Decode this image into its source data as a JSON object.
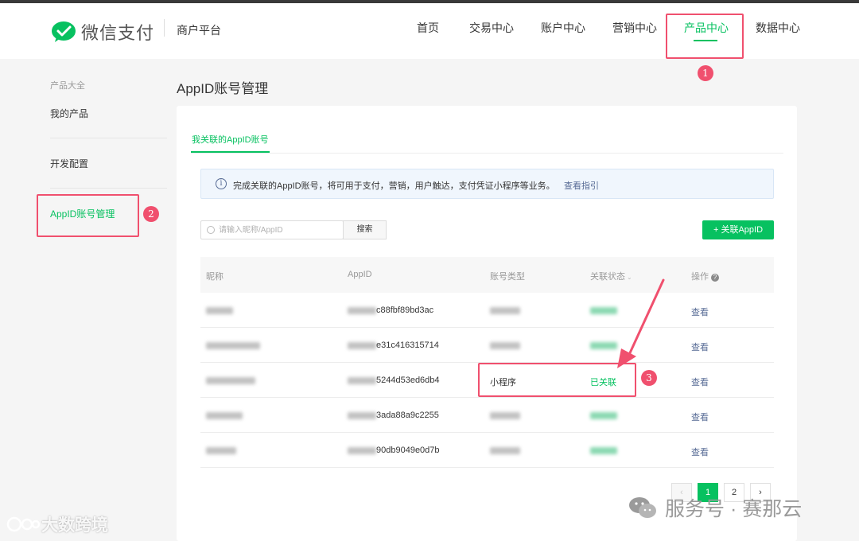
{
  "header": {
    "logo_text": "微信支付",
    "platform": "商户平台",
    "nav": [
      {
        "label": "首页",
        "active": false
      },
      {
        "label": "交易中心",
        "active": false
      },
      {
        "label": "账户中心",
        "active": false
      },
      {
        "label": "营销中心",
        "active": false
      },
      {
        "label": "产品中心",
        "active": true
      },
      {
        "label": "数据中心",
        "active": false
      }
    ]
  },
  "sidebar": {
    "group_label": "产品大全",
    "items": [
      {
        "label": "我的产品",
        "active": false
      },
      {
        "label": "开发配置",
        "active": false
      },
      {
        "label": "AppID账号管理",
        "active": true
      }
    ]
  },
  "page": {
    "title": "AppID账号管理",
    "tab_label": "我关联的AppID账号",
    "notice": {
      "text": "完成关联的AppID账号，将可用于支付，营销，用户触达，支付凭证小程序等业务。",
      "link": "查看指引"
    },
    "search": {
      "placeholder": "请输入昵称/AppID",
      "button_label": "搜索"
    },
    "add_button": "+ 关联AppID"
  },
  "table": {
    "headers": {
      "nickname": "昵称",
      "appid": "AppID",
      "type": "账号类型",
      "status": "关联状态",
      "action": "操作"
    },
    "rows": [
      {
        "appid_suffix": "c88fbf89bd3ac",
        "type": "",
        "status": "",
        "action": "查看"
      },
      {
        "appid_suffix": "e31c416315714",
        "type": "",
        "status": "",
        "action": "查看"
      },
      {
        "appid_suffix": "5244d53ed6db4",
        "type": "小程序",
        "status": "已关联",
        "action": "查看"
      },
      {
        "appid_suffix": "3ada88a9c2255",
        "type": "",
        "status": "",
        "action": "查看"
      },
      {
        "appid_suffix": "90db9049e0d7b",
        "type": "",
        "status": "",
        "action": "查看"
      }
    ]
  },
  "pagination": {
    "prev": "‹",
    "pages": [
      "1",
      "2"
    ],
    "current": "1",
    "next": "›"
  },
  "annotations": {
    "step1": "1",
    "step2": "2",
    "step3": "3"
  },
  "watermarks": {
    "left": "大数跨境",
    "right": "服务号 · 赛那云"
  },
  "colors": {
    "brand_green": "#07c160",
    "highlight_red": "#f0506e",
    "link_blue": "#576b95"
  }
}
